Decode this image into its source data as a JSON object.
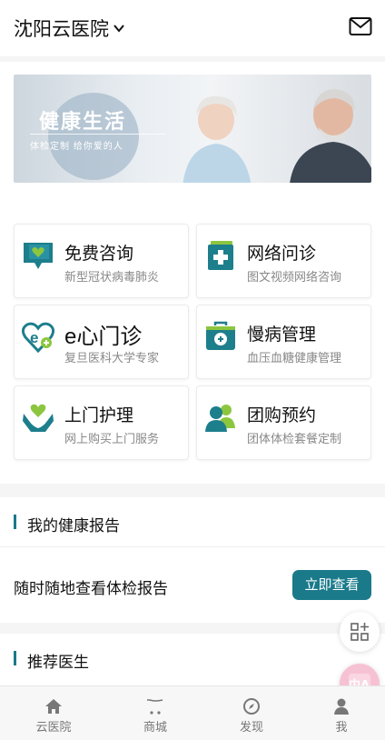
{
  "header": {
    "city_label": "沈阳云医院",
    "dropdown_icon": "chevron-down-icon",
    "mail_icon": "mail-icon"
  },
  "banner": {
    "title": "健康生活",
    "subtitle": "体检定制    给你爱的人"
  },
  "services": [
    {
      "title": "免费咨询",
      "subtitle": "新型冠状病毒肺炎",
      "icon": "chat-heart-icon"
    },
    {
      "title": "网络问诊",
      "subtitle": "图文视频网络咨询",
      "icon": "medical-book-icon"
    },
    {
      "title": "e心门诊",
      "subtitle": "复旦医科大学专家",
      "icon": "e-heart-icon"
    },
    {
      "title": "慢病管理",
      "subtitle": "血压血糖健康管理",
      "icon": "medical-kit-icon"
    },
    {
      "title": "上门护理",
      "subtitle": "网上购买上门服务",
      "icon": "care-hands-icon"
    },
    {
      "title": "团购预约",
      "subtitle": "团体体检套餐定制",
      "icon": "group-people-icon"
    }
  ],
  "health_report": {
    "section_title": "我的健康报告",
    "message": "随时随地查看体检报告",
    "button_label": "立即查看"
  },
  "recommended_doctors": {
    "section_title": "推荐医生"
  },
  "floating": {
    "grid_icon": "apps-grid-icon",
    "translate_icon": "translate-icon",
    "translate_text": "中A"
  },
  "tabbar": [
    {
      "label": "云医院",
      "icon": "home-icon"
    },
    {
      "label": "商城",
      "icon": "cart-icon"
    },
    {
      "label": "发现",
      "icon": "compass-icon"
    },
    {
      "label": "我",
      "icon": "user-icon"
    }
  ],
  "colors": {
    "accent": "#1a7a8a",
    "icon_green": "#8cc63f",
    "icon_teal": "#1d7e8c"
  }
}
